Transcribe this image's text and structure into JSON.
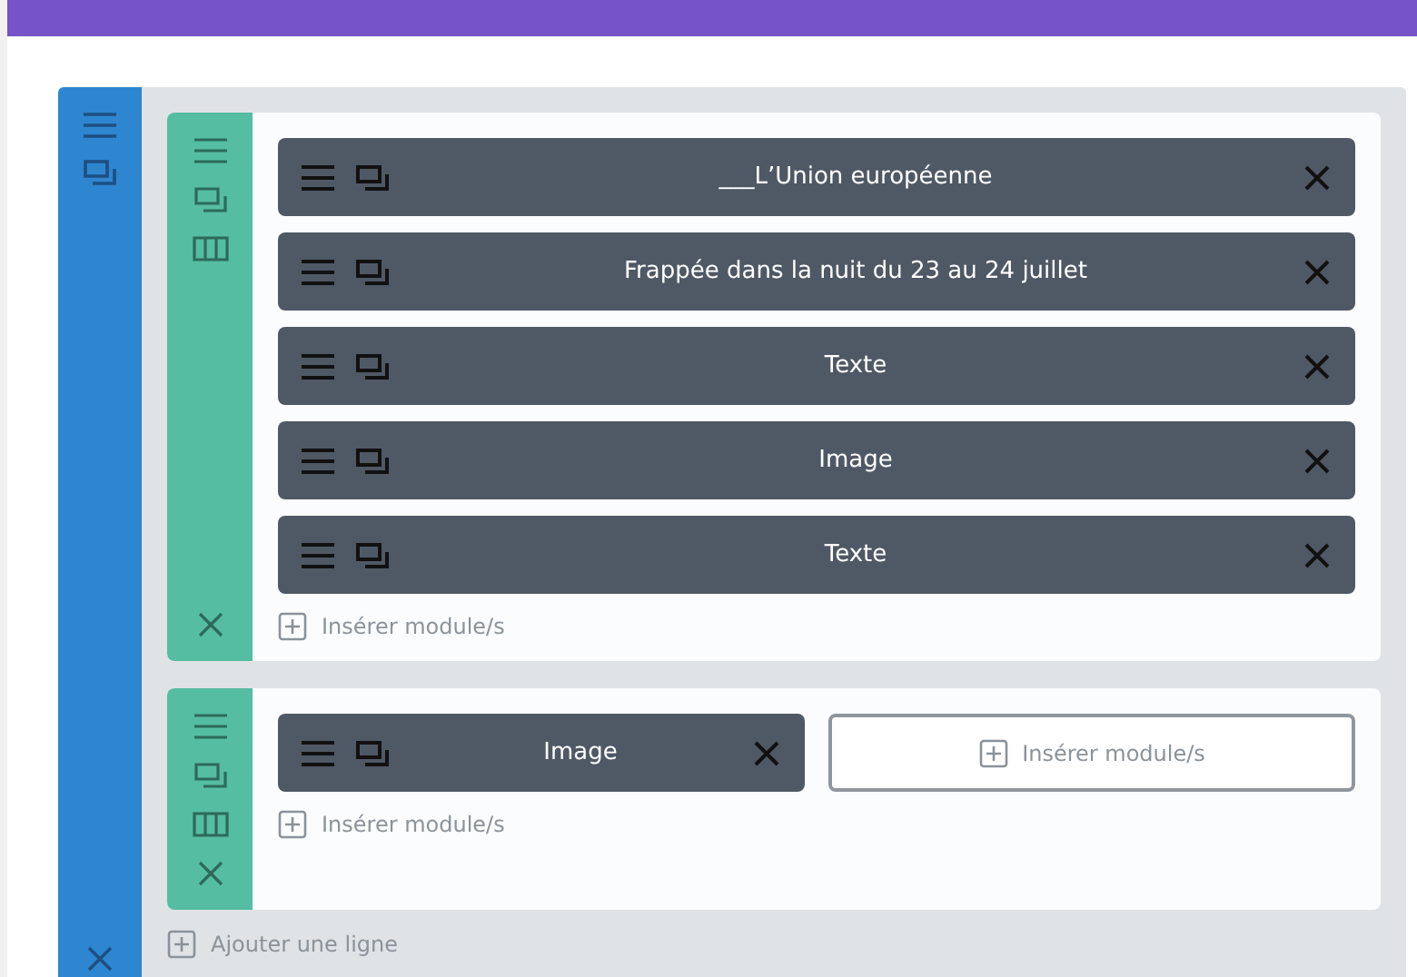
{
  "section": {
    "rows": [
      {
        "columns": [
          {
            "kind": "filled",
            "modules": [
              {
                "title": "___L’Union européenne"
              },
              {
                "title": "Frappée dans la nuit du 23 au 24 juillet"
              },
              {
                "title": "Texte"
              },
              {
                "title": "Image"
              },
              {
                "title": "Texte"
              }
            ],
            "insert_label": "Insérer module/s"
          }
        ]
      },
      {
        "columns": [
          {
            "kind": "filled",
            "modules": [
              {
                "title": "Image"
              }
            ],
            "insert_label": "Insérer module/s"
          },
          {
            "kind": "empty",
            "insert_label": "Insérer module/s"
          }
        ]
      }
    ],
    "add_row_label": "Ajouter une ligne"
  }
}
